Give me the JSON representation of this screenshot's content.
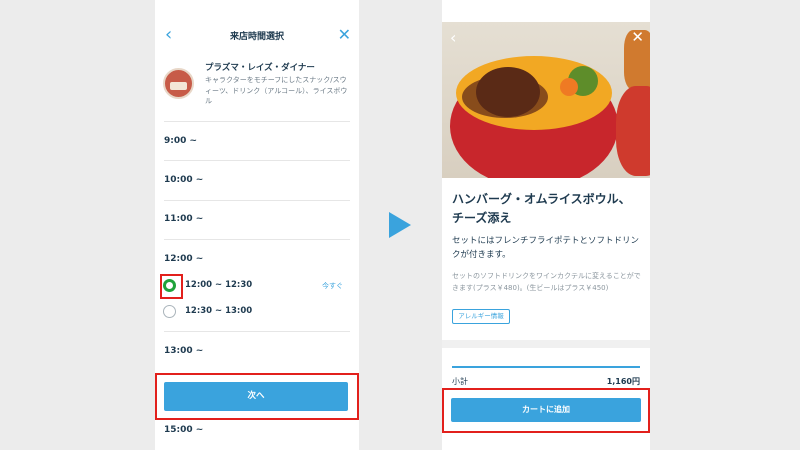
{
  "left": {
    "title": "来店時間選択",
    "back_icon": "chevron-left-icon",
    "close_icon": "close-icon",
    "shop": {
      "name": "プラズマ・レイズ・ダイナー",
      "description": "キャラクターをモチーフにしたスナック/スウィーツ、ドリンク（アルコール）、ライスボウル"
    },
    "slots": [
      "9:00 ~",
      "10:00 ~",
      "11:00 ~",
      "12:00 ~",
      "13:00 ~",
      "15:00 ~"
    ],
    "options": [
      {
        "label": "12:00 ~ 12:30",
        "badge": "今すぐ",
        "selected": true
      },
      {
        "label": "12:30 ~ 13:00",
        "selected": false
      }
    ],
    "next_button": "次へ"
  },
  "right": {
    "back_icon": "chevron-left-icon",
    "close_icon": "close-icon",
    "title_line1": "ハンバーグ・オムライスボウル、",
    "title_line2": "チーズ添え",
    "subtitle": "セットにはフレンチフライポテトとソフトドリンクが付きます。",
    "note": "セットのソフトドリンクをワインカクテルに変えることができます(プラス￥480)。(生ビールはプラス￥450)",
    "allergy_button": "アレルギー情報",
    "subtotal_label": "小計",
    "subtotal_value": "1,160円",
    "cart_button": "カートに追加"
  },
  "colors": {
    "accent": "#3aa3dd",
    "highlight": "#e2201c",
    "selected": "#1fa33b"
  }
}
